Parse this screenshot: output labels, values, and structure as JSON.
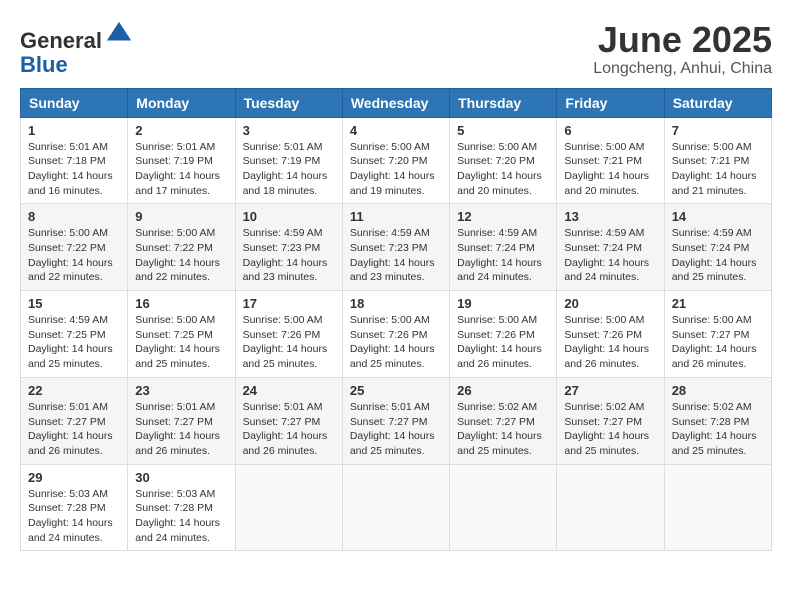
{
  "header": {
    "logo_line1": "General",
    "logo_line2": "Blue",
    "month_year": "June 2025",
    "location": "Longcheng, Anhui, China"
  },
  "weekdays": [
    "Sunday",
    "Monday",
    "Tuesday",
    "Wednesday",
    "Thursday",
    "Friday",
    "Saturday"
  ],
  "weeks": [
    [
      {
        "day": 1,
        "sunrise": "5:01 AM",
        "sunset": "7:18 PM",
        "daylight": "14 hours and 16 minutes."
      },
      {
        "day": 2,
        "sunrise": "5:01 AM",
        "sunset": "7:19 PM",
        "daylight": "14 hours and 17 minutes."
      },
      {
        "day": 3,
        "sunrise": "5:01 AM",
        "sunset": "7:19 PM",
        "daylight": "14 hours and 18 minutes."
      },
      {
        "day": 4,
        "sunrise": "5:00 AM",
        "sunset": "7:20 PM",
        "daylight": "14 hours and 19 minutes."
      },
      {
        "day": 5,
        "sunrise": "5:00 AM",
        "sunset": "7:20 PM",
        "daylight": "14 hours and 20 minutes."
      },
      {
        "day": 6,
        "sunrise": "5:00 AM",
        "sunset": "7:21 PM",
        "daylight": "14 hours and 20 minutes."
      },
      {
        "day": 7,
        "sunrise": "5:00 AM",
        "sunset": "7:21 PM",
        "daylight": "14 hours and 21 minutes."
      }
    ],
    [
      {
        "day": 8,
        "sunrise": "5:00 AM",
        "sunset": "7:22 PM",
        "daylight": "14 hours and 22 minutes."
      },
      {
        "day": 9,
        "sunrise": "5:00 AM",
        "sunset": "7:22 PM",
        "daylight": "14 hours and 22 minutes."
      },
      {
        "day": 10,
        "sunrise": "4:59 AM",
        "sunset": "7:23 PM",
        "daylight": "14 hours and 23 minutes."
      },
      {
        "day": 11,
        "sunrise": "4:59 AM",
        "sunset": "7:23 PM",
        "daylight": "14 hours and 23 minutes."
      },
      {
        "day": 12,
        "sunrise": "4:59 AM",
        "sunset": "7:24 PM",
        "daylight": "14 hours and 24 minutes."
      },
      {
        "day": 13,
        "sunrise": "4:59 AM",
        "sunset": "7:24 PM",
        "daylight": "14 hours and 24 minutes."
      },
      {
        "day": 14,
        "sunrise": "4:59 AM",
        "sunset": "7:24 PM",
        "daylight": "14 hours and 25 minutes."
      }
    ],
    [
      {
        "day": 15,
        "sunrise": "4:59 AM",
        "sunset": "7:25 PM",
        "daylight": "14 hours and 25 minutes."
      },
      {
        "day": 16,
        "sunrise": "5:00 AM",
        "sunset": "7:25 PM",
        "daylight": "14 hours and 25 minutes."
      },
      {
        "day": 17,
        "sunrise": "5:00 AM",
        "sunset": "7:26 PM",
        "daylight": "14 hours and 25 minutes."
      },
      {
        "day": 18,
        "sunrise": "5:00 AM",
        "sunset": "7:26 PM",
        "daylight": "14 hours and 25 minutes."
      },
      {
        "day": 19,
        "sunrise": "5:00 AM",
        "sunset": "7:26 PM",
        "daylight": "14 hours and 26 minutes."
      },
      {
        "day": 20,
        "sunrise": "5:00 AM",
        "sunset": "7:26 PM",
        "daylight": "14 hours and 26 minutes."
      },
      {
        "day": 21,
        "sunrise": "5:00 AM",
        "sunset": "7:27 PM",
        "daylight": "14 hours and 26 minutes."
      }
    ],
    [
      {
        "day": 22,
        "sunrise": "5:01 AM",
        "sunset": "7:27 PM",
        "daylight": "14 hours and 26 minutes."
      },
      {
        "day": 23,
        "sunrise": "5:01 AM",
        "sunset": "7:27 PM",
        "daylight": "14 hours and 26 minutes."
      },
      {
        "day": 24,
        "sunrise": "5:01 AM",
        "sunset": "7:27 PM",
        "daylight": "14 hours and 26 minutes."
      },
      {
        "day": 25,
        "sunrise": "5:01 AM",
        "sunset": "7:27 PM",
        "daylight": "14 hours and 25 minutes."
      },
      {
        "day": 26,
        "sunrise": "5:02 AM",
        "sunset": "7:27 PM",
        "daylight": "14 hours and 25 minutes."
      },
      {
        "day": 27,
        "sunrise": "5:02 AM",
        "sunset": "7:27 PM",
        "daylight": "14 hours and 25 minutes."
      },
      {
        "day": 28,
        "sunrise": "5:02 AM",
        "sunset": "7:28 PM",
        "daylight": "14 hours and 25 minutes."
      }
    ],
    [
      {
        "day": 29,
        "sunrise": "5:03 AM",
        "sunset": "7:28 PM",
        "daylight": "14 hours and 24 minutes."
      },
      {
        "day": 30,
        "sunrise": "5:03 AM",
        "sunset": "7:28 PM",
        "daylight": "14 hours and 24 minutes."
      },
      null,
      null,
      null,
      null,
      null
    ]
  ]
}
